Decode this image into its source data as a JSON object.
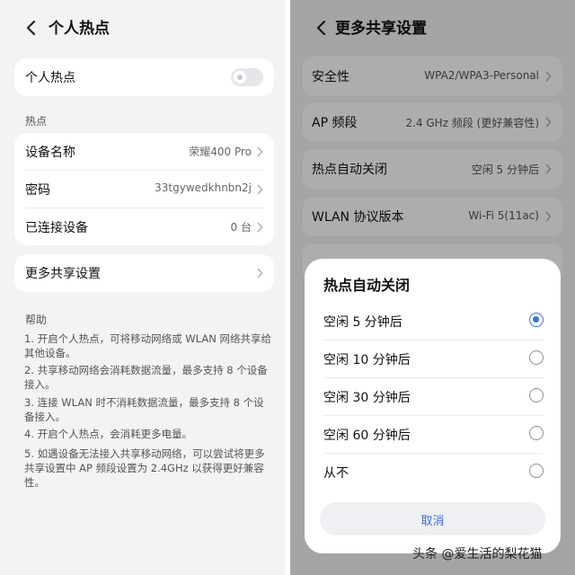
{
  "left": {
    "title": "个人热点",
    "hotspot_toggle": {
      "label": "个人热点",
      "enabled": false
    },
    "section_label": "热点",
    "rows": [
      {
        "label": "设备名称",
        "value": "荣耀400 Pro"
      },
      {
        "label": "密码",
        "value": "33tgywedkhnbn2j"
      },
      {
        "label": "已连接设备",
        "value": "0 台"
      }
    ],
    "more_settings": {
      "label": "更多共享设置"
    },
    "help": {
      "title": "帮助",
      "lines": [
        "1. 开启个人热点，可将移动网络或 WLAN 网络共享给其他设备。",
        "2. 共享移动网络会消耗数据流量，最多支持 8 个设备接入。",
        "3. 连接 WLAN 时不消耗数据流量，最多支持 8 个设备接入。",
        "4. 开启个人热点，会消耗更多电量。",
        "5. 如遇设备无法接入共享移动网络，可以尝试将更多共享设置中 AP 频段设置为 2.4GHz 以获得更好兼容性。"
      ]
    }
  },
  "right": {
    "title": "更多共享设置",
    "rows": [
      {
        "label": "安全性",
        "value": "WPA2/WPA3-Personal"
      },
      {
        "label": "AP 频段",
        "value": "2.4 GHz 频段 (更好兼容性)"
      },
      {
        "label": "热点自动关闭",
        "value": "空闲 5 分钟后"
      },
      {
        "label": "WLAN 协议版本",
        "value": "Wi-Fi 5(11ac)"
      }
    ],
    "dialog": {
      "title": "热点自动关闭",
      "options": [
        {
          "label": "空闲 5 分钟后",
          "selected": true
        },
        {
          "label": "空闲 10 分钟后",
          "selected": false
        },
        {
          "label": "空闲 30 分钟后",
          "selected": false
        },
        {
          "label": "空闲 60 分钟后",
          "selected": false
        },
        {
          "label": "从不",
          "selected": false
        }
      ],
      "cancel_label": "取消"
    }
  },
  "watermark": "头条 @爱生活的梨花猫",
  "colors": {
    "accent": "#3b6fe0",
    "background": "#f1f3f5"
  },
  "icons": {
    "back": "back-arrow-icon",
    "chevron": "chevron-right-icon"
  }
}
